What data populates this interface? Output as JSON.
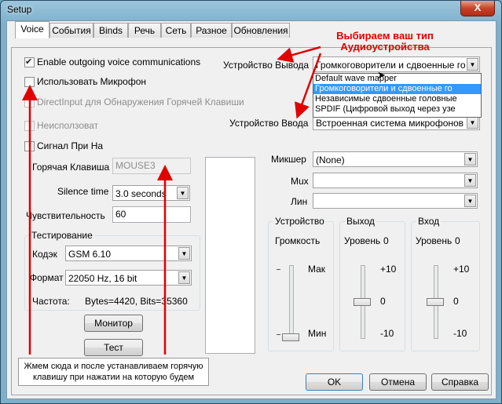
{
  "window": {
    "title": "Setup",
    "close_glyph": "X"
  },
  "tabs": [
    "Voice",
    "События",
    "Binds",
    "Речь",
    "Сеть",
    "Разное",
    "Обновления"
  ],
  "voice": {
    "enable_outgoing": "Enable outgoing voice communications",
    "use_mic": "Использовать Микрофон",
    "directinput": "DirectInput для Обнаружения Горячей Клавиши",
    "not_used": "Неисползоват",
    "signal": "Сигнал При На",
    "hotkey_label": "Горячая Клавиша",
    "hotkey_value": "MOUSE3",
    "silence_label": "Silence time",
    "silence_value": "3.0 seconds",
    "sensitivity_label": "Чувствительность",
    "sensitivity_value": "60"
  },
  "testing": {
    "title": "Тестирование",
    "codec_label": "Кодэк",
    "codec_value": "GSM 6.10",
    "format_label": "Формат",
    "format_value": "22050 Hz, 16 bit",
    "freq_label": "Частота:",
    "freq_value": "Bytes=4420, Bits=35360"
  },
  "buttons": {
    "monitor": "Монитор",
    "test": "Тест",
    "ok": "OK",
    "cancel": "Отмена",
    "help": "Справка"
  },
  "devices": {
    "output_label": "Устройство Вывода",
    "output_value": "Громкоговорители и сдвоенные го",
    "input_label": "Устройство Ввода",
    "input_value": "Встроенная система микрофонов (ID",
    "options": [
      "Default wave mapper",
      "Громкоговорители и сдвоенные го",
      "Независимые сдвоенные головные",
      "SPDIF (Цифровой выход через узе"
    ],
    "selected_index": 1
  },
  "mixer": {
    "mixer_label": "Микшер",
    "mixer_value": "(None)",
    "mux_label": "Mux",
    "line_label": "Лин"
  },
  "volume_groups": {
    "device": {
      "title": "Устройство",
      "level_label": "Громкость",
      "max": "Мак",
      "min": "Мин"
    },
    "output": {
      "title": "Выход",
      "level_label": "Уровень",
      "level_value": "0",
      "top": "+10",
      "mid": "0",
      "bottom": "-10"
    },
    "input": {
      "title": "Вход",
      "level_label": "Уровень",
      "level_value": "0",
      "top": "+10",
      "mid": "0",
      "bottom": "-10"
    }
  },
  "annotations": {
    "top_line1": "Выбираем ваш тип",
    "top_line2": "Аудиоустройства",
    "note_line1": "Жмем сюда и после устанавливаем горячую",
    "note_line2": "клавишу при нажатии на которую будем"
  },
  "colors": {
    "annotation": "#e00000",
    "selection": "#3399ff"
  }
}
